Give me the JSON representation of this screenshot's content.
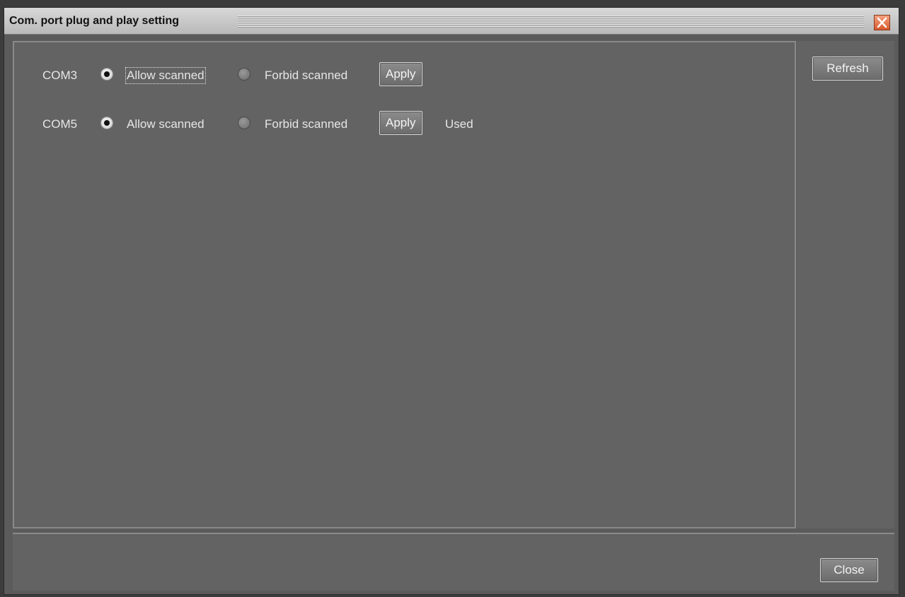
{
  "window": {
    "title": "Com. port plug and play setting",
    "close_icon": "close-x-icon",
    "close_icon_color": "#d85a2e"
  },
  "ports": [
    {
      "name": "COM3",
      "allow_label": "Allow scanned",
      "forbid_label": "Forbid scanned",
      "selected": "allow",
      "apply_label": "Apply",
      "status": ""
    },
    {
      "name": "COM5",
      "allow_label": "Allow scanned",
      "forbid_label": "Forbid scanned",
      "selected": "allow",
      "apply_label": "Apply",
      "status": "Used"
    }
  ],
  "actions": {
    "refresh_label": "Refresh",
    "close_label": "Close"
  }
}
